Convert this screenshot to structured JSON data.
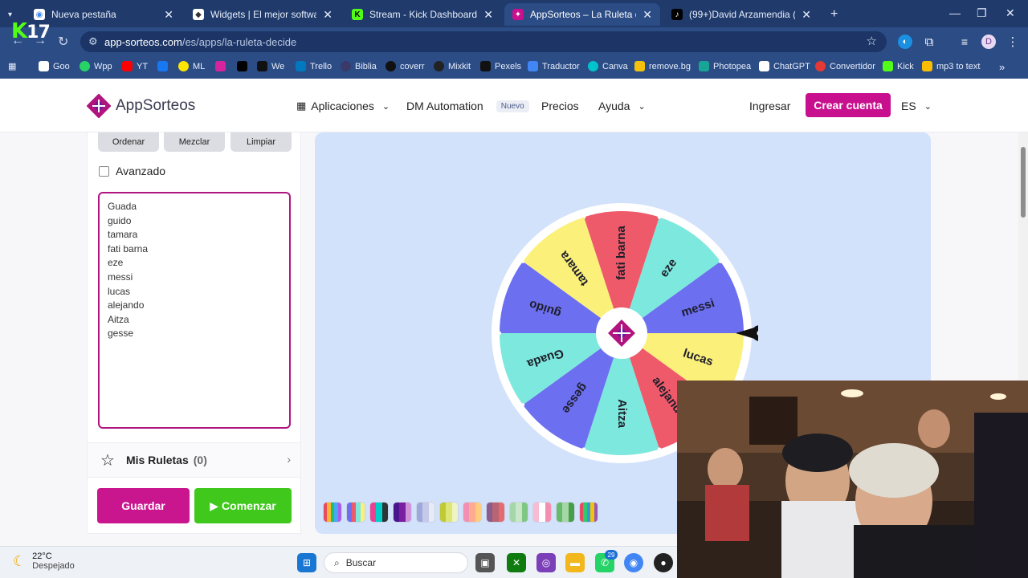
{
  "browser": {
    "tabs": [
      {
        "title": "Nueva pestaña",
        "close": "✕"
      },
      {
        "title": "Widgets | El mejor software par",
        "close": "✕"
      },
      {
        "title": "Stream - Kick Dashboard",
        "close": "✕"
      },
      {
        "title": "AppSorteos – La Ruleta de la Su",
        "close": "✕"
      },
      {
        "title": "(99+)David Arzamendia (@davi",
        "close": "✕"
      }
    ],
    "new_tab": "+",
    "url_host": "app-sorteos.com",
    "url_path": "/es/apps/la-ruleta-decide",
    "profile_initial": "D",
    "overlay_logo_k": "K",
    "overlay_logo_num": "17",
    "bookmarks": [
      "Goo",
      "Wpp",
      "YT",
      "",
      "ML",
      "",
      "",
      "We",
      "Trello",
      "Biblia",
      "coverr",
      "Mixkit",
      "Pexels",
      "Traductor",
      "Canva",
      "remove.bg",
      "Photopea",
      "ChatGPT",
      "Convertidor",
      "Kick",
      "mp3 to text"
    ]
  },
  "site": {
    "brand": "AppSorteos",
    "nav": {
      "apps": "Aplicaciones",
      "dm": "DM Automation",
      "new_badge": "Nuevo",
      "prices": "Precios",
      "help": "Ayuda",
      "login": "Ingresar",
      "create": "Crear cuenta",
      "lang": "ES"
    }
  },
  "panel": {
    "tools": [
      "Ordenar",
      "Mezclar",
      "Limpiar"
    ],
    "advanced_label": "Avanzado",
    "names": [
      "Guada",
      "guido",
      "tamara",
      "fati barna",
      "eze",
      "messi",
      "lucas",
      "alejando",
      "Aitza",
      "gesse"
    ],
    "my_wheels_label": "Mis Ruletas",
    "my_wheels_count": "(0)",
    "save_label": "Guardar",
    "start_label": "Comenzar"
  },
  "wheel": {
    "segments": [
      {
        "label": "fati barna",
        "color": "#ee5a6a"
      },
      {
        "label": "eze",
        "color": "#7de8dd"
      },
      {
        "label": "messi",
        "color": "#6b6ff0"
      },
      {
        "label": "lucas",
        "color": "#fbf07a"
      },
      {
        "label": "alejando",
        "color": "#ee5a6a"
      },
      {
        "label": "Aitza",
        "color": "#7de8dd"
      },
      {
        "label": "gesse",
        "color": "#6b6ff0"
      },
      {
        "label": "Guada",
        "color": "#7de8dd"
      },
      {
        "label": "guido",
        "color": "#6b6ff0"
      },
      {
        "label": "tamara",
        "color": "#fbf07a"
      }
    ],
    "palettes": [
      [
        "#e84a5f",
        "#f7b731",
        "#20bf6b",
        "#45aaf2",
        "#a55eea"
      ],
      [
        "#6b6ff0",
        "#ee5a6a",
        "#7de8dd",
        "#fbf07a"
      ],
      [
        "#e84393",
        "#00cec9",
        "#2d3436"
      ],
      [
        "#4a148c",
        "#7b1fa2",
        "#ce93d8"
      ],
      [
        "#9fa8da",
        "#c5cae9",
        "#e8eaf6"
      ],
      [
        "#c0ca33",
        "#dce775",
        "#f0f4c3"
      ],
      [
        "#f48fb1",
        "#ffab91",
        "#ffcc80"
      ],
      [
        "#8d5b8a",
        "#b56576",
        "#e56b6f"
      ],
      [
        "#a5d6a7",
        "#c8e6c9",
        "#81c784"
      ],
      [
        "#f8bbd0",
        "#ffffff",
        "#f48fb1"
      ],
      [
        "#66bb6a",
        "#a5d6a7",
        "#43a047"
      ],
      [
        "#e84a5f",
        "#2ecc71",
        "#3498db",
        "#f1c40f",
        "#9b59b6"
      ]
    ]
  },
  "taskbar": {
    "temp": "22°C",
    "weather": "Despejado",
    "search_placeholder": "Buscar",
    "wa_badge": "29"
  }
}
